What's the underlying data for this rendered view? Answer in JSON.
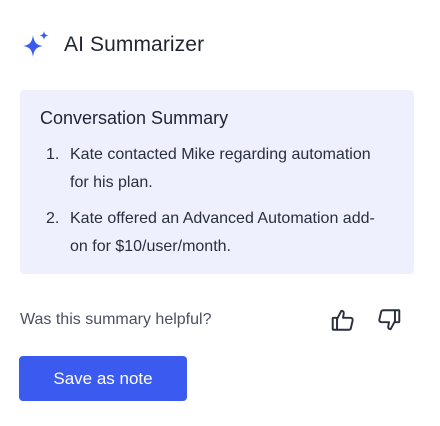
{
  "header": {
    "icon": "sparkle-icon",
    "title": "AI Summarizer"
  },
  "summary": {
    "title": "Conversation Summary",
    "items": [
      {
        "number": "1.",
        "text": "Kate contacted Mike regarding automation for his plan."
      },
      {
        "number": "2.",
        "text": "Kate offered an Advanced Automation add-on for $10/user/month."
      }
    ]
  },
  "feedback": {
    "question": "Was this summary helpful?",
    "thumbs_up_icon": "thumbs-up-icon",
    "thumbs_down_icon": "thumbs-down-icon"
  },
  "actions": {
    "save_label": "Save as note"
  },
  "colors": {
    "accent": "#3b5bf0",
    "card_background": "#eef1fd",
    "text": "#1f2433"
  }
}
